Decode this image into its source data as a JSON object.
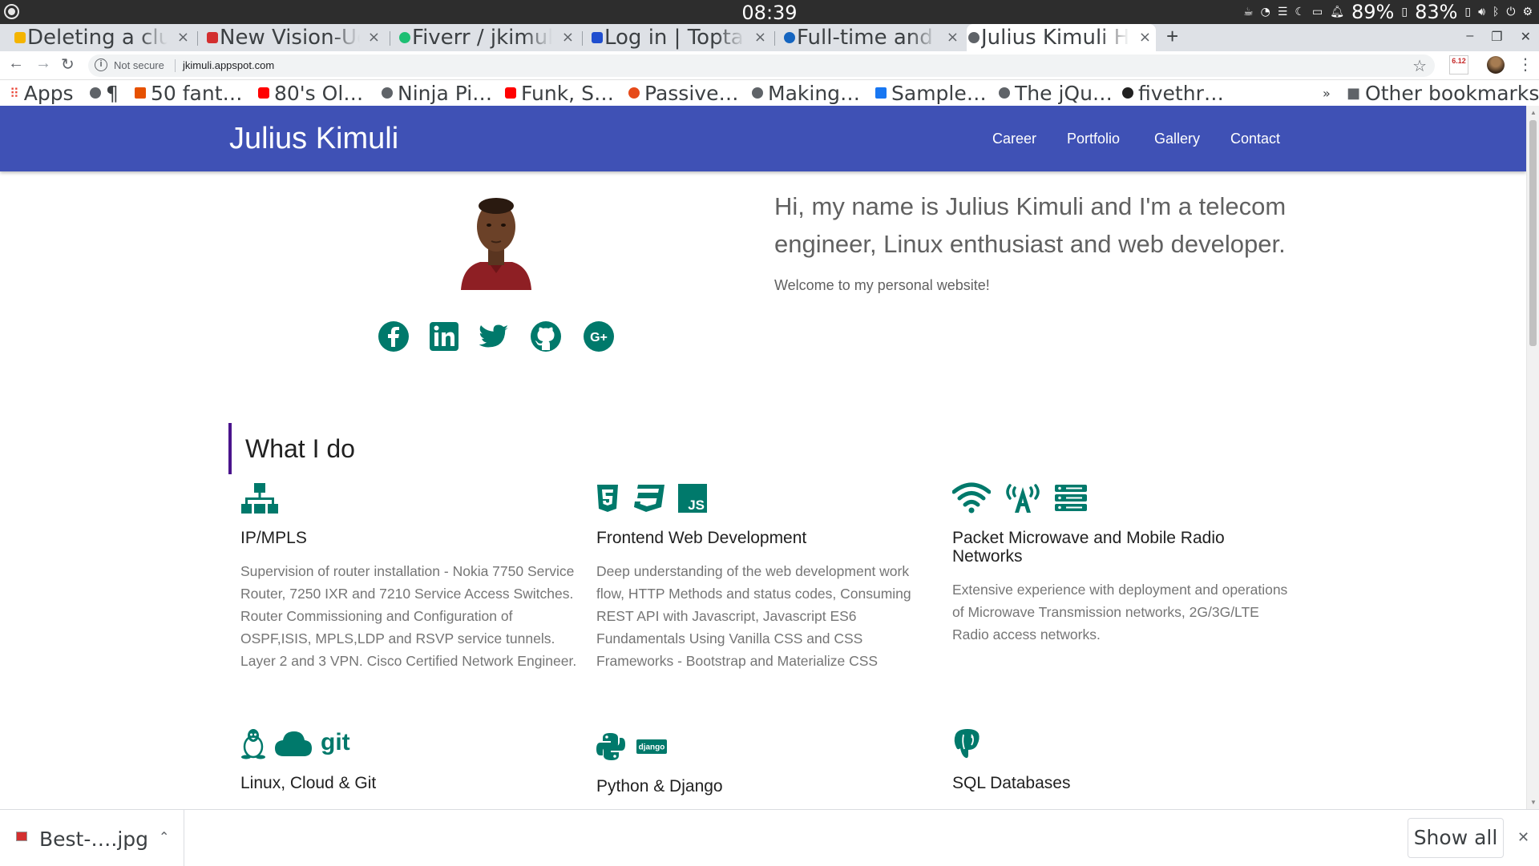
{
  "os": {
    "clock": "08:39",
    "battery1": "89%",
    "battery2": "83%"
  },
  "browser": {
    "tabs": [
      {
        "title": "Deleting a clust",
        "favicon_color": "#f4b400"
      },
      {
        "title": "New Vision-Uga",
        "favicon_color": "#d32f2f"
      },
      {
        "title": "Fiverr / jkimuli /",
        "favicon_color": "#1dbf73"
      },
      {
        "title": "Log in | Toptal",
        "favicon_color": "#204ecf"
      },
      {
        "title": "Full-time and Re",
        "favicon_color": "#1565c0"
      },
      {
        "title": "Julius Kimuli Ho",
        "favicon_color": "#5f6368",
        "active": true
      }
    ],
    "new_tab_label": "+",
    "security_label": "Not secure",
    "url": "jkimuli.appspot.com",
    "extension_badge": "6.12",
    "bookmarks": [
      {
        "label": "Apps",
        "icon_color": "#4285f4"
      },
      {
        "label": "¶",
        "icon_color": "#5f6368"
      },
      {
        "label": "50 fant…",
        "icon_color": "#e65100"
      },
      {
        "label": "80's Ol…",
        "icon_color": "#ff0000"
      },
      {
        "label": "Ninja Pi…",
        "icon_color": "#5f6368"
      },
      {
        "label": "Funk, S…",
        "icon_color": "#ff0000"
      },
      {
        "label": "Passive…",
        "icon_color": "#e64a19"
      },
      {
        "label": "Making…",
        "icon_color": "#5f6368"
      },
      {
        "label": "Sample…",
        "icon_color": "#1877f2"
      },
      {
        "label": "The jQu…",
        "icon_color": "#5f6368"
      },
      {
        "label": "fivethr…",
        "icon_color": "#212121"
      }
    ],
    "bookmarks_overflow": "»",
    "other_bookmarks": "Other bookmarks"
  },
  "site": {
    "brand": "Julius Kimuli",
    "nav": [
      "Career",
      "Portfolio",
      "Gallery",
      "Contact"
    ],
    "intro": "Hi, my name is Julius Kimuli and I'm a telecom engineer, Linux enthusiast and web developer.",
    "intro_small": "Welcome to my personal website!",
    "social_icons": [
      "facebook-icon",
      "linkedin-icon",
      "twitter-icon",
      "github-icon",
      "google-plus-icon"
    ],
    "accent_color": "#00796b",
    "navbar_color": "#3f51b5",
    "section_title": "What I do",
    "skills": [
      {
        "title": "IP/MPLS",
        "icons": [
          "network-icon"
        ],
        "description": "Supervision of router installation - Nokia 7750 Service Router, 7250 IXR and 7210 Service Access Switches. Router Commissioning and Configuration of OSPF,ISIS, MPLS,LDP and RSVP service tunnels. Layer 2 and 3 VPN. Cisco Certified Network Engineer."
      },
      {
        "title": "Frontend Web Development",
        "icons": [
          "html5-icon",
          "css3-icon",
          "js-icon"
        ],
        "js_label": "JS",
        "description": "Deep understanding of the web development work flow, HTTP Methods and status codes, Consuming REST API with Javascript, Javascript ES6 Fundamentals Using Vanilla CSS and CSS Frameworks - Bootstrap and Materialize CSS"
      },
      {
        "title": "Packet Microwave and Mobile Radio Networks",
        "icons": [
          "wifi-icon",
          "antenna-icon",
          "server-icon"
        ],
        "description": "Extensive experience with deployment and operations of Microwave Transmission networks, 2G/3G/LTE Radio access networks."
      },
      {
        "title": "Linux, Cloud & Git",
        "icons": [
          "linux-icon",
          "cloud-icon",
          "git-icon"
        ],
        "git_label": "git"
      },
      {
        "title": "Python & Django",
        "icons": [
          "python-icon",
          "django-icon"
        ],
        "django_label": "django"
      },
      {
        "title": "SQL Databases",
        "icons": [
          "postgresql-icon"
        ]
      }
    ]
  },
  "downloads": {
    "file_name": "Best-….jpg",
    "show_all": "Show all"
  }
}
